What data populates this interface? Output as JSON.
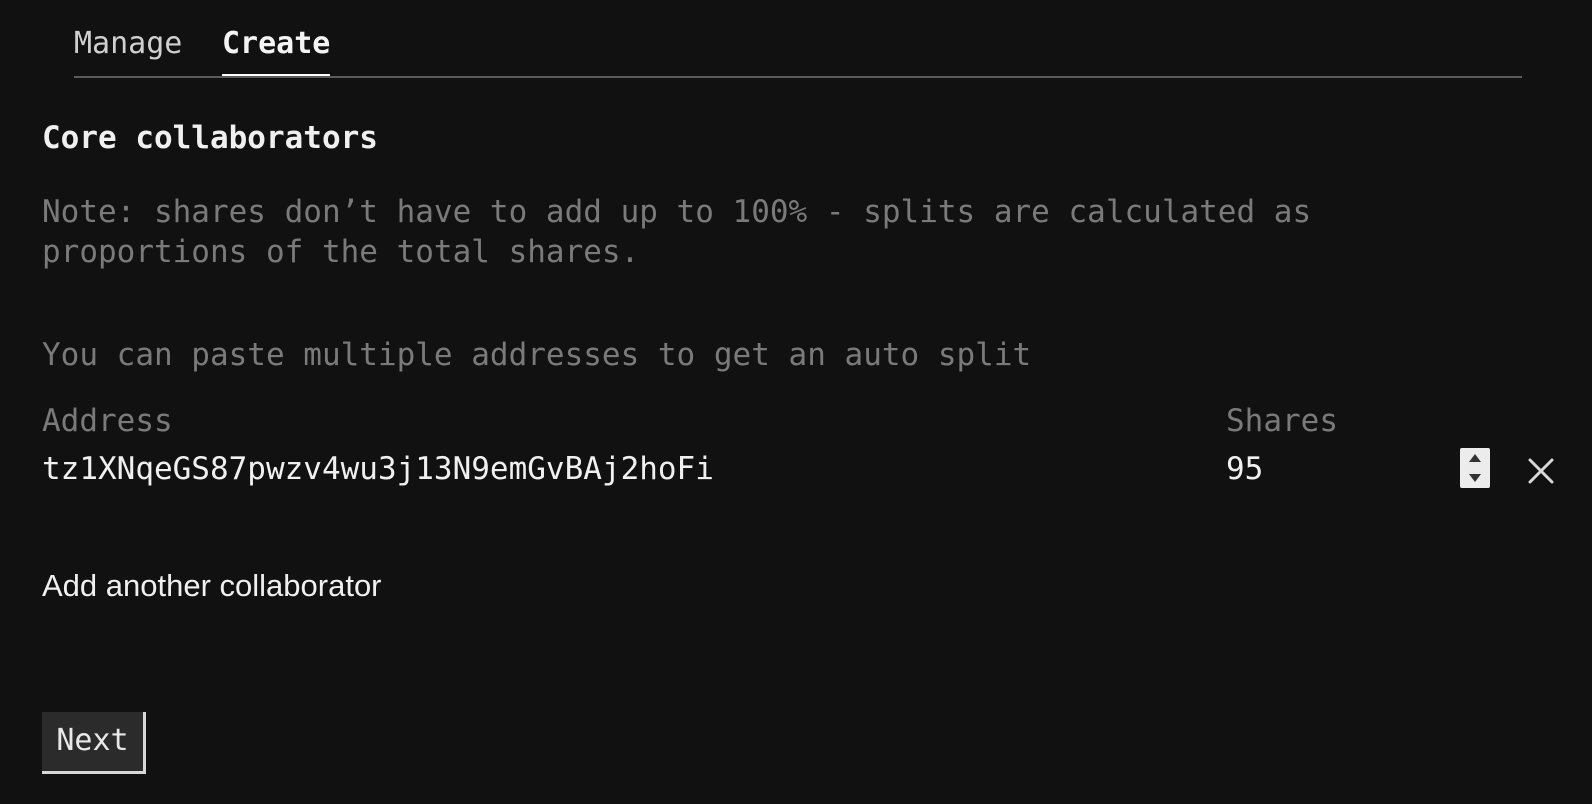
{
  "tabs": [
    {
      "label": "Manage",
      "active": false
    },
    {
      "label": "Create",
      "active": true
    }
  ],
  "section": {
    "title": "Core collaborators",
    "note": "Note: shares don’t have to add up to 100% - splits are calculated as proportions of the total shares.",
    "hint": "You can paste multiple addresses to get an auto split"
  },
  "collaborators": {
    "address_label": "Address",
    "shares_label": "Shares",
    "rows": [
      {
        "address": "tz1XNqeGS87pwzv4wu3j13N9emGvBAj2hoFi",
        "shares": "95"
      }
    ],
    "add_label": "Add another collaborator"
  },
  "actions": {
    "next_label": "Next"
  },
  "icons": {
    "remove": "close-icon",
    "spinner_up": "chevron-up-icon",
    "spinner_down": "chevron-down-icon"
  },
  "colors": {
    "background": "#111111",
    "text": "#f0f0f0",
    "muted": "#7a7a7a",
    "divider": "#5a5a5a"
  }
}
